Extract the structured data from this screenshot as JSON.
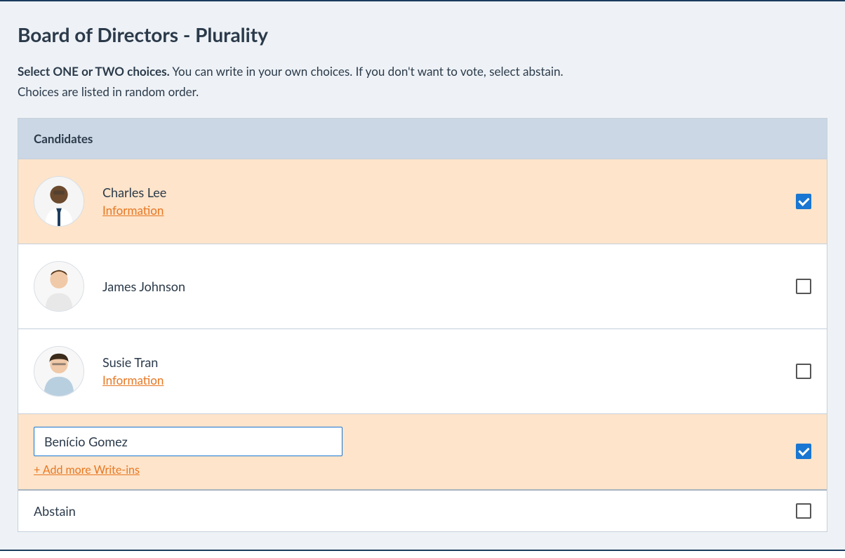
{
  "title": "Board of Directors - Plurality",
  "instructions": {
    "bold": "Select ONE or TWO choices.",
    "rest": " You can write in your own choices. If you don't want to vote, select abstain.",
    "line2": "Choices are listed in random order."
  },
  "header": "Candidates",
  "candidates": [
    {
      "name": "Charles Lee",
      "info_label": "Information",
      "has_info": true,
      "selected": true
    },
    {
      "name": "James Johnson",
      "info_label": "",
      "has_info": false,
      "selected": false
    },
    {
      "name": "Susie Tran",
      "info_label": "Information",
      "has_info": true,
      "selected": false
    }
  ],
  "writein": {
    "value": "Benício Gomez",
    "add_more": "+ Add more Write-ins",
    "selected": true
  },
  "abstain": {
    "label": "Abstain",
    "selected": false
  }
}
